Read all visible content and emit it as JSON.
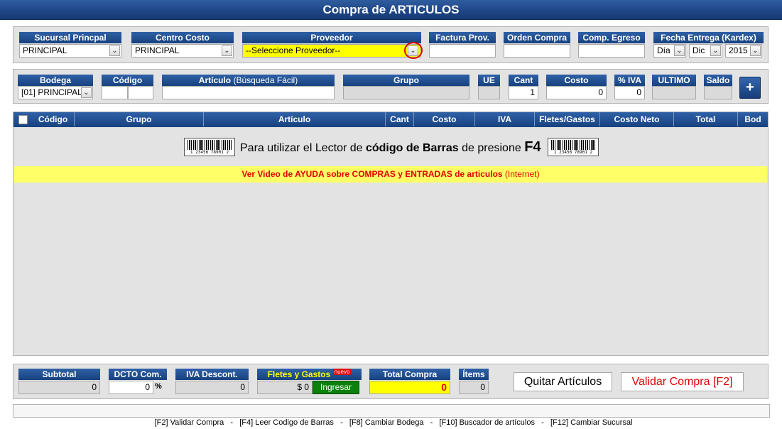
{
  "window": {
    "title": "Compra de ARTICULOS"
  },
  "row1": {
    "sucursal": {
      "label": "Sucursal Princpal",
      "value": "PRINCIPAL"
    },
    "centro": {
      "label": "Centro Costo",
      "value": "PRINCIPAL"
    },
    "proveedor": {
      "label": "Proveedor",
      "value": "--Seleccione Proveedor--"
    },
    "factura": {
      "label": "Factura Prov.",
      "value": ""
    },
    "orden": {
      "label": "Orden Compra",
      "value": ""
    },
    "egreso": {
      "label": "Comp. Egreso",
      "value": ""
    },
    "fecha": {
      "label": "Fecha Entrega (Kardex)",
      "day": "Día",
      "month": "Dic",
      "year": "2015"
    }
  },
  "row2": {
    "bodega": {
      "label": "Bodega",
      "value": "[01] PRINCIPAL"
    },
    "codigo": {
      "label": "Código"
    },
    "articulo": {
      "label": "Artículo",
      "hint": "(Búsqueda Fácil)"
    },
    "grupo": {
      "label": "Grupo"
    },
    "ue": {
      "label": "UE"
    },
    "cant": {
      "label": "Cant",
      "value": "1"
    },
    "costo": {
      "label": "Costo",
      "value": "0"
    },
    "iva": {
      "label": "% IVA",
      "value": "0"
    },
    "ultimo": {
      "label": "ULTIMO"
    },
    "saldo": {
      "label": "Saldo"
    },
    "add_icon": "+"
  },
  "table": {
    "columns": [
      "Código",
      "Grupo",
      "Artículo",
      "Cant",
      "Costo",
      "IVA",
      "Fletes/Gastos",
      "Costo Neto",
      "Total",
      "Bod"
    ],
    "barcode_msg": {
      "pre": "Para utilizar el Lector de ",
      "bold": "código de Barras",
      "post": " de presione ",
      "key": "F4"
    },
    "barcode_digits": "1 23456 78901 2",
    "help_link": {
      "text": "Ver Video de AYUDA sobre COMPRAS y ENTRADAS de articulos",
      "suffix": "(Internet)"
    }
  },
  "footer": {
    "subtotal": {
      "label": "Subtotal",
      "value": "0"
    },
    "dcto": {
      "label": "DCTO Com.",
      "value": "0",
      "unit": "%"
    },
    "iva_desc": {
      "label": "IVA Descont.",
      "value": "0"
    },
    "fletes": {
      "label": "Fletes y Gastos",
      "badge": "nuevo",
      "value": "$ 0",
      "button": "Ingresar"
    },
    "total": {
      "label": "Total Compra",
      "value": "0"
    },
    "items": {
      "label": "Ítems",
      "value": "0"
    },
    "quitar_button": "Quitar Artículos",
    "validar_button": "Validar Compra [F2]"
  },
  "status_bar": "[F2] Validar Compra   -   [F4] Leer Codigo de Barras   -   [F8] Cambiar Bodega   -   [F10] Buscador de artículos   -   [F12] Cambiar Sucursal",
  "colors": {
    "header_blue": "#1d4586",
    "proveedor_yellow": "#ffff00",
    "help_red": "#e00000",
    "validar_red": "#e00000",
    "ingresar_green": "#0d7f0d"
  }
}
